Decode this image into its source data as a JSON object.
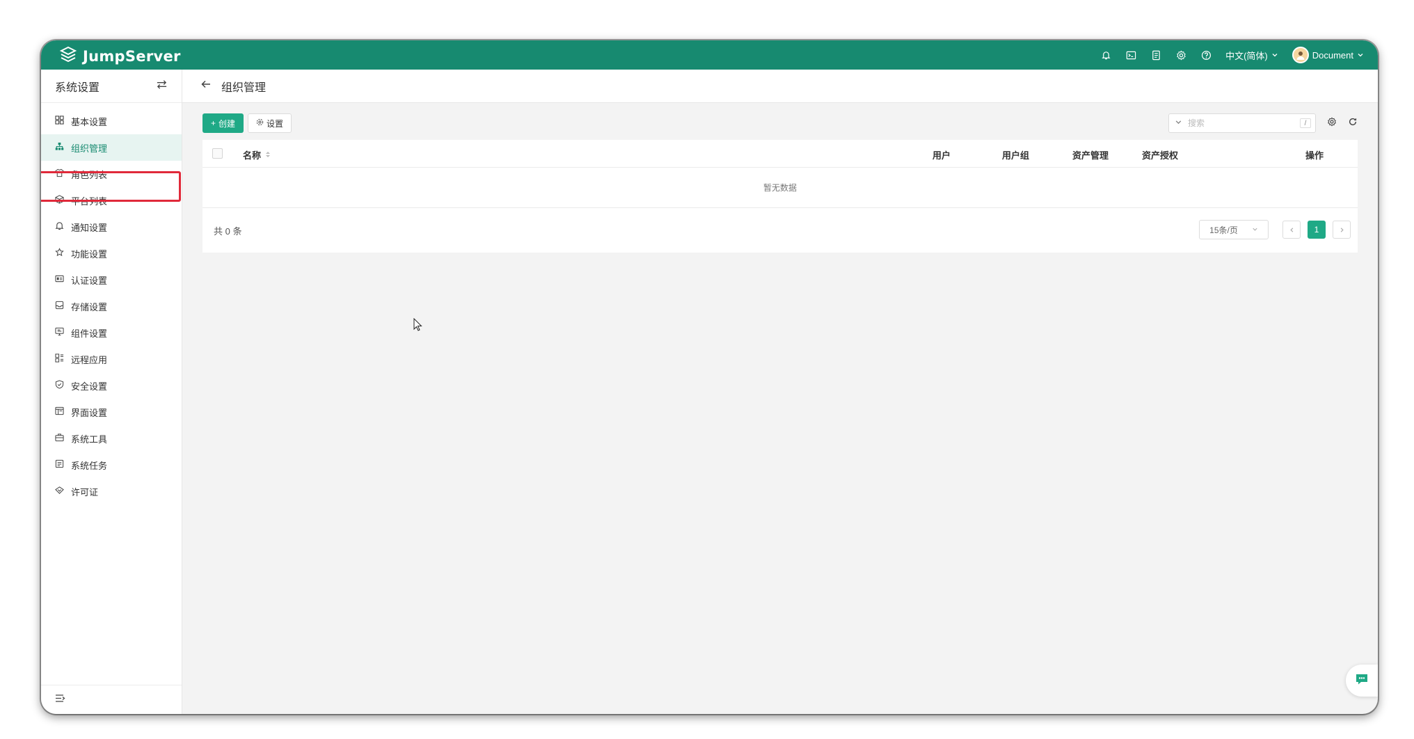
{
  "topbar": {
    "brand": "JumpServer",
    "language": "中文(简体)",
    "user": "Document",
    "icons": [
      "bell-icon",
      "terminal-icon",
      "file-icon",
      "gear-icon",
      "help-icon"
    ]
  },
  "sidebar": {
    "title": "系统设置",
    "items": [
      {
        "label": "基本设置",
        "icon": "grid-icon"
      },
      {
        "label": "组织管理",
        "icon": "org-icon",
        "active": true
      },
      {
        "label": "角色列表",
        "icon": "shirt-icon"
      },
      {
        "label": "平台列表",
        "icon": "cube-icon"
      },
      {
        "label": "通知设置",
        "icon": "bell-icon"
      },
      {
        "label": "功能设置",
        "icon": "star-icon"
      },
      {
        "label": "认证设置",
        "icon": "id-card-icon"
      },
      {
        "label": "存储设置",
        "icon": "inbox-icon"
      },
      {
        "label": "组件设置",
        "icon": "monitor-icon"
      },
      {
        "label": "远程应用",
        "icon": "apps-icon"
      },
      {
        "label": "安全设置",
        "icon": "shield-icon"
      },
      {
        "label": "界面设置",
        "icon": "layout-icon"
      },
      {
        "label": "系统工具",
        "icon": "toolbox-icon"
      },
      {
        "label": "系统任务",
        "icon": "task-icon"
      },
      {
        "label": "许可证",
        "icon": "license-icon"
      }
    ]
  },
  "main": {
    "page_title": "组织管理",
    "toolbar": {
      "create_label": "创建",
      "settings_label": "设置",
      "search_placeholder": "搜索",
      "search_shortcut": "/"
    },
    "table": {
      "columns": [
        "名称",
        "用户",
        "用户组",
        "资产管理",
        "资产授权",
        "操作"
      ],
      "empty_text": "暂无数据"
    },
    "pagination": {
      "total_text": "共 0 条",
      "page_size": "15条/页",
      "current_page": "1"
    }
  },
  "colors": {
    "brand": "#178a70",
    "primary": "#1fa986",
    "highlight": "#e0293a"
  }
}
